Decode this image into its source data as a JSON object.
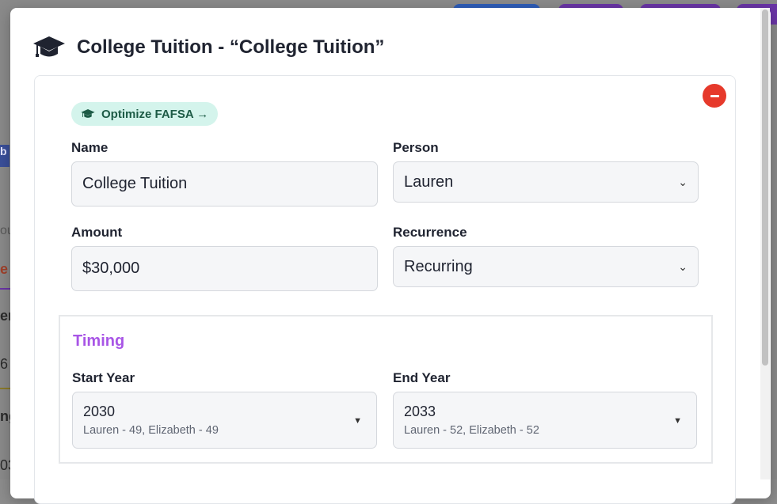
{
  "colors": {
    "accent_purple": "#a855e6",
    "remove_red": "#e6392b",
    "fafsa_bg": "#d4f4ec",
    "fafsa_text": "#1d5b46"
  },
  "modal": {
    "icon": "graduation-cap-icon",
    "title": "College Tuition - “College Tuition”"
  },
  "card": {
    "remove_icon": "minus-icon",
    "fafsa_button": {
      "icon": "graduation-cap-icon",
      "label": "Optimize FAFSA →"
    },
    "name": {
      "label": "Name",
      "value": "College Tuition"
    },
    "person": {
      "label": "Person",
      "value": "Lauren"
    },
    "amount": {
      "label": "Amount",
      "value": "$30,000"
    },
    "recurrence": {
      "label": "Recurrence",
      "value": "Recurring"
    },
    "timing": {
      "title": "Timing",
      "start_year": {
        "label": "Start Year",
        "value": "2030",
        "ages": "Lauren - 49, Elizabeth - 49"
      },
      "end_year": {
        "label": "End Year",
        "value": "2033",
        "ages": "Lauren - 52, Elizabeth - 52"
      }
    }
  },
  "background": {
    "edge_texts": [
      "b",
      "ou",
      "e",
      "er",
      "6",
      "ng",
      "03"
    ]
  }
}
